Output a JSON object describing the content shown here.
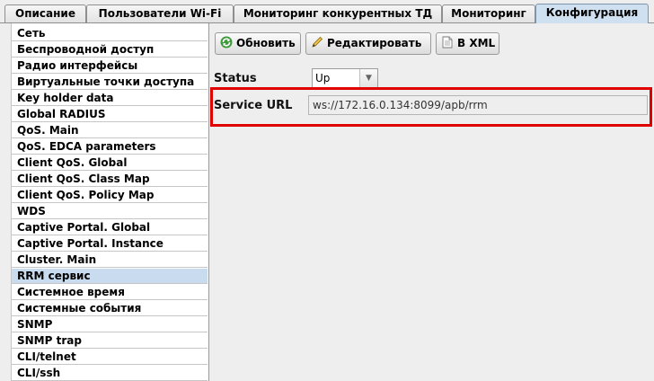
{
  "tabs": [
    {
      "label": "Описание"
    },
    {
      "label": "Пользователи Wi-Fi"
    },
    {
      "label": "Мониторинг конкурентных ТД"
    },
    {
      "label": "Мониторинг"
    },
    {
      "label": "Конфигурация",
      "active": true
    }
  ],
  "sidebar": {
    "selected_index": 16,
    "items": [
      {
        "label": "Сеть"
      },
      {
        "label": "Беспроводной доступ"
      },
      {
        "label": "Радио интерфейсы"
      },
      {
        "label": "Виртуальные точки доступа"
      },
      {
        "label": "Key holder data"
      },
      {
        "label": "Global RADIUS"
      },
      {
        "label": "QoS. Main"
      },
      {
        "label": "QoS. EDCA parameters"
      },
      {
        "label": "Client QoS. Global"
      },
      {
        "label": "Client QoS. Class Map"
      },
      {
        "label": "Client QoS. Policy Map"
      },
      {
        "label": "WDS"
      },
      {
        "label": "Captive Portal. Global"
      },
      {
        "label": "Captive Portal. Instance"
      },
      {
        "label": "Cluster. Main"
      },
      {
        "label": "RRM сервис"
      },
      {
        "label": "Системное время"
      },
      {
        "label": "Системные события"
      },
      {
        "label": "SNMP"
      },
      {
        "label": "SNMP trap"
      },
      {
        "label": "CLI/telnet"
      },
      {
        "label": "CLI/ssh"
      }
    ]
  },
  "toolbar": {
    "refresh_label": "Обновить",
    "edit_label": "Редактировать",
    "xml_label": "В XML",
    "refresh_icon": "refresh-icon",
    "edit_icon": "pencil-icon",
    "xml_icon": "document-icon"
  },
  "form": {
    "status_label": "Status",
    "status_value": "Up",
    "service_url_label": "Service URL",
    "service_url_value": "ws://172.16.0.134:8099/apb/rrm"
  },
  "colors": {
    "highlight": "#e10000",
    "selected_item": "#c9dbee",
    "active_tab": "#cfe0f1"
  }
}
